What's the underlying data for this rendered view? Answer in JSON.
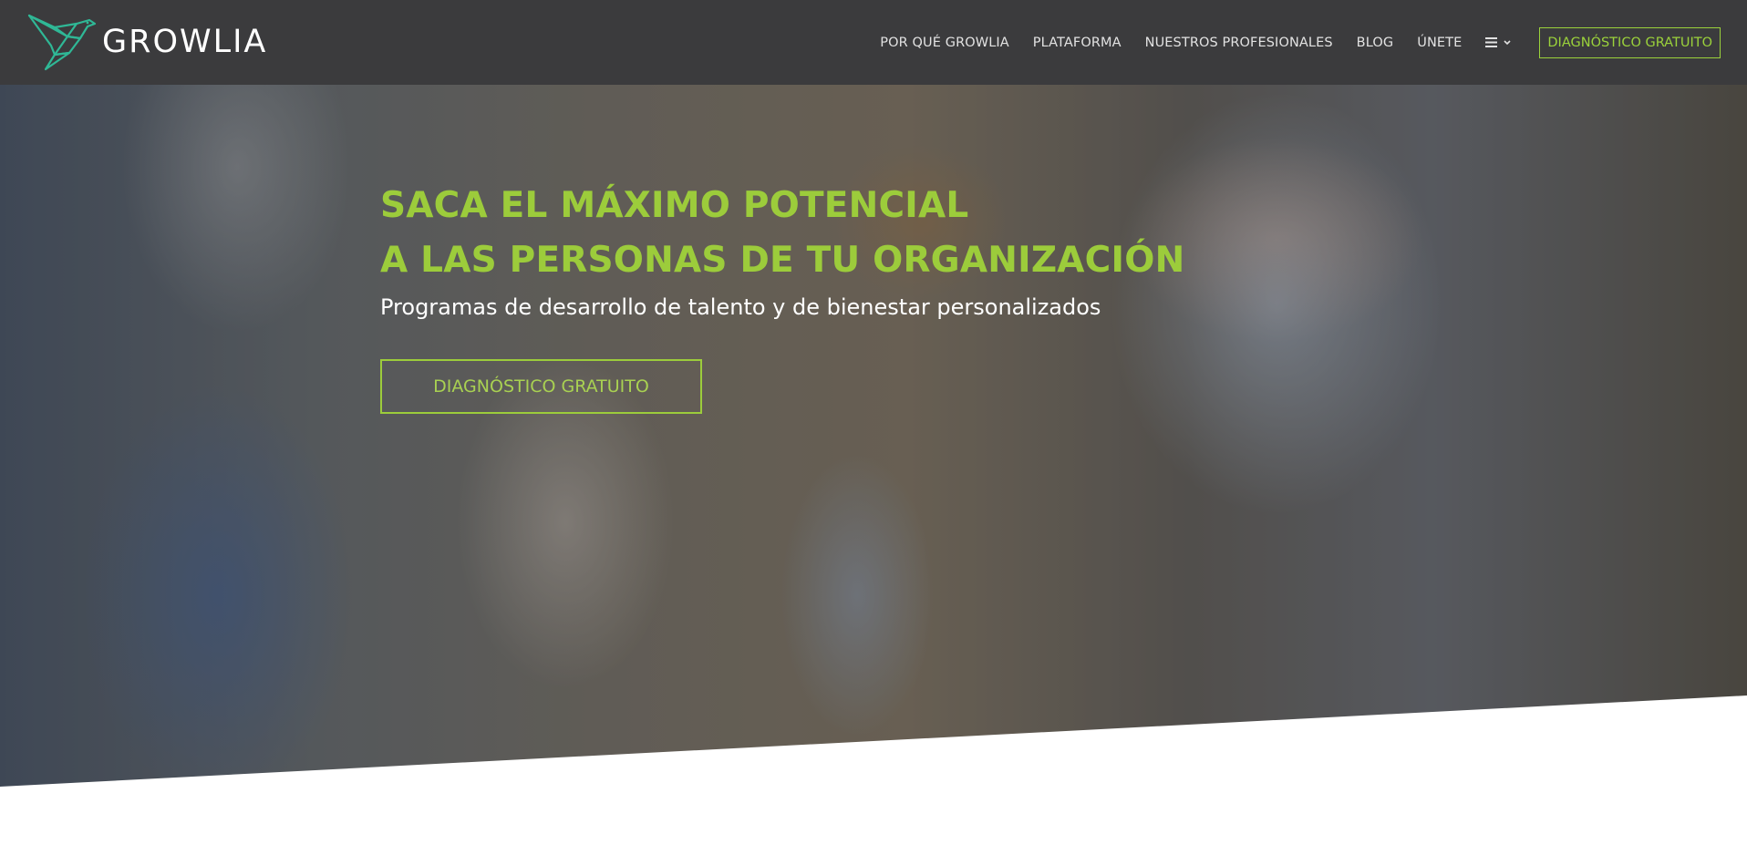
{
  "brand": {
    "name": "GROWLIA",
    "colors": {
      "header_bg": "#3b3b3d",
      "accent_green": "#9ccc3b",
      "logo_teal": "#2fb896"
    }
  },
  "nav": {
    "items": [
      {
        "label": "POR QUÉ GROWLIA"
      },
      {
        "label": "PLATAFORMA"
      },
      {
        "label": "NUESTROS PROFESIONALES"
      },
      {
        "label": "BLOG"
      },
      {
        "label": "ÚNETE"
      }
    ],
    "more_icon": "hamburger-icon",
    "more_chevron": "chevron-down-icon",
    "cta_label": "DIAGNÓSTICO GRATUITO"
  },
  "hero": {
    "title_line1": "SACA EL MÁXIMO POTENCIAL",
    "title_line2": "A LAS PERSONAS DE TU ORGANIZACIÓN",
    "subtitle": "Programas de desarrollo de talento y de bienestar personalizados",
    "cta_label": "DIAGNÓSTICO GRATUITO"
  }
}
